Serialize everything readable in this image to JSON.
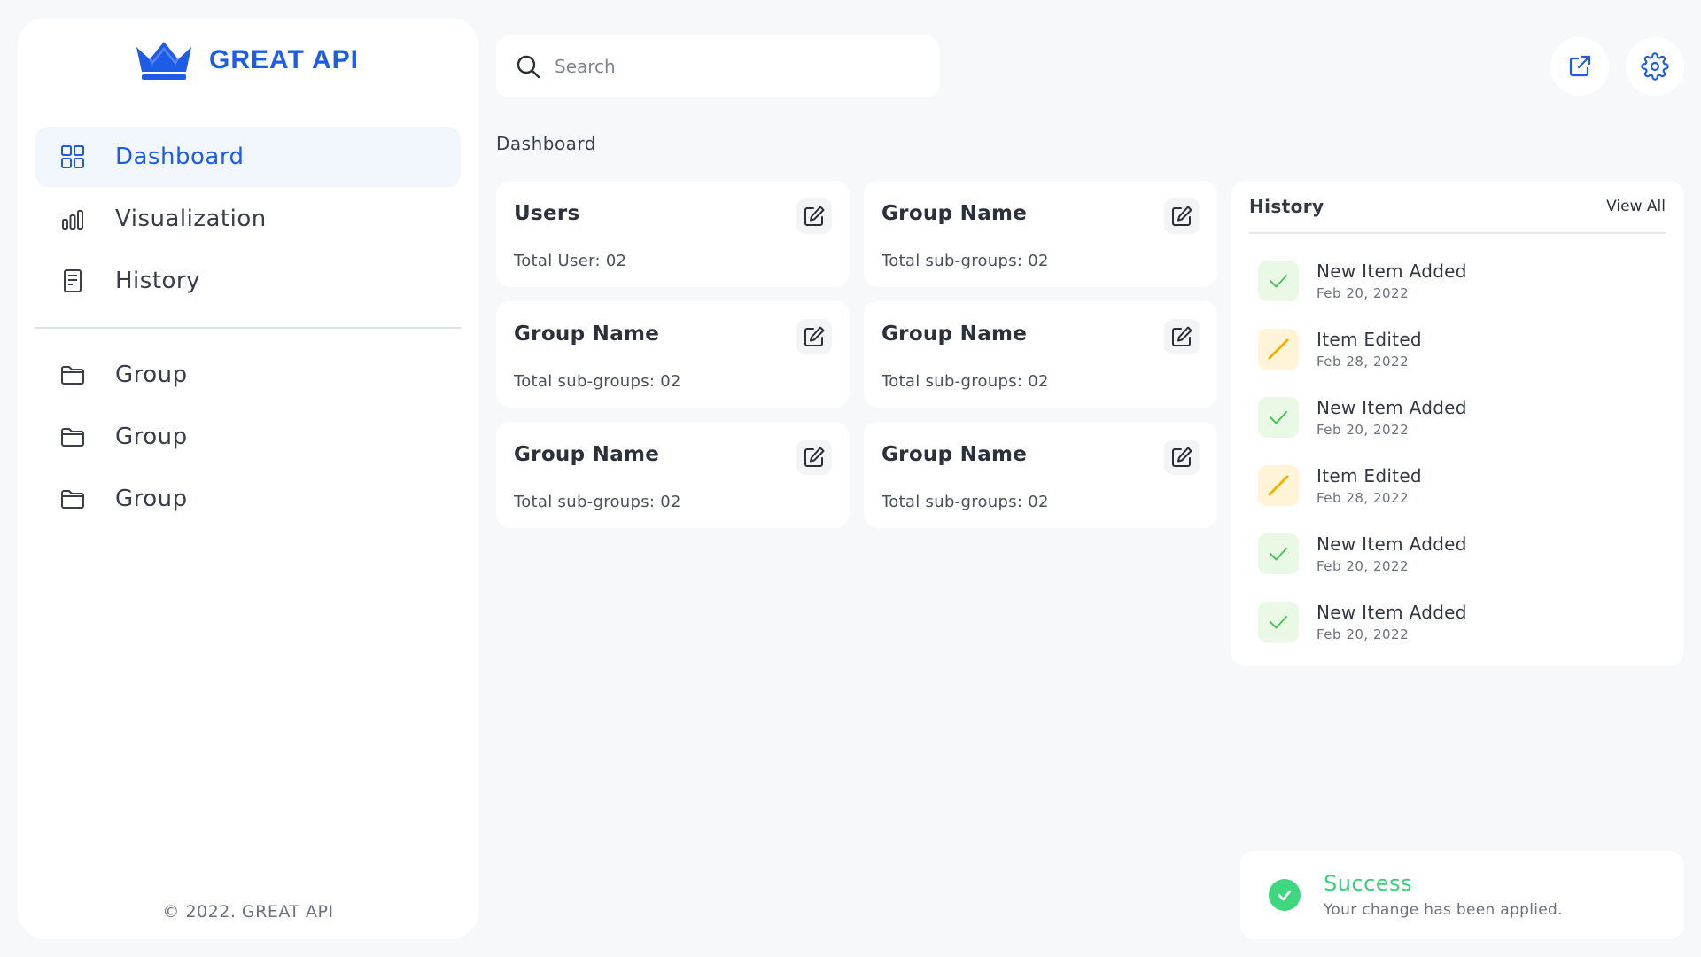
{
  "brand": {
    "name": "GREAT API",
    "accent": "#1d5ce6",
    "icon": "crown-icon"
  },
  "sidebar": {
    "primary": [
      {
        "label": "Dashboard",
        "icon": "grid-icon",
        "active": true
      },
      {
        "label": "Visualization",
        "icon": "bar-chart-icon"
      },
      {
        "label": "History",
        "icon": "document-icon"
      }
    ],
    "groups": [
      {
        "label": "Group",
        "icon": "folder-icon"
      },
      {
        "label": "Group",
        "icon": "folder-icon"
      },
      {
        "label": "Group",
        "icon": "folder-icon"
      }
    ],
    "copyright": "© 2022. GREAT API"
  },
  "search": {
    "placeholder": "Search",
    "value": ""
  },
  "header_actions": [
    {
      "icon": "external-link-icon"
    },
    {
      "icon": "gear-icon"
    }
  ],
  "page": {
    "title": "Dashboard"
  },
  "cards": [
    {
      "title": "Users",
      "subtitle": "Total User: 02"
    },
    {
      "title": "Group Name",
      "subtitle": "Total sub-groups: 02"
    },
    {
      "title": "Group Name",
      "subtitle": "Total sub-groups: 02"
    },
    {
      "title": "Group Name",
      "subtitle": "Total sub-groups: 02"
    },
    {
      "title": "Group Name",
      "subtitle": "Total sub-groups: 02"
    },
    {
      "title": "Group Name",
      "subtitle": "Total sub-groups: 02"
    }
  ],
  "history": {
    "title": "History",
    "view_all": "View All",
    "items": [
      {
        "title": "New Item Added",
        "date": "Feb 20, 2022",
        "type": "added"
      },
      {
        "title": "Item Edited",
        "date": "Feb 28, 2022",
        "type": "edited"
      },
      {
        "title": "New Item Added",
        "date": "Feb 20, 2022",
        "type": "added"
      },
      {
        "title": "Item Edited",
        "date": "Feb 28, 2022",
        "type": "edited"
      },
      {
        "title": "New Item Added",
        "date": "Feb 20, 2022",
        "type": "added"
      },
      {
        "title": "New Item Added",
        "date": "Feb 20, 2022",
        "type": "added"
      }
    ]
  },
  "toast": {
    "title": "Success",
    "message": "Your change has been applied.",
    "color": "#35d177"
  },
  "colors": {
    "added": "#4cc35a",
    "edited": "#f0b400"
  }
}
